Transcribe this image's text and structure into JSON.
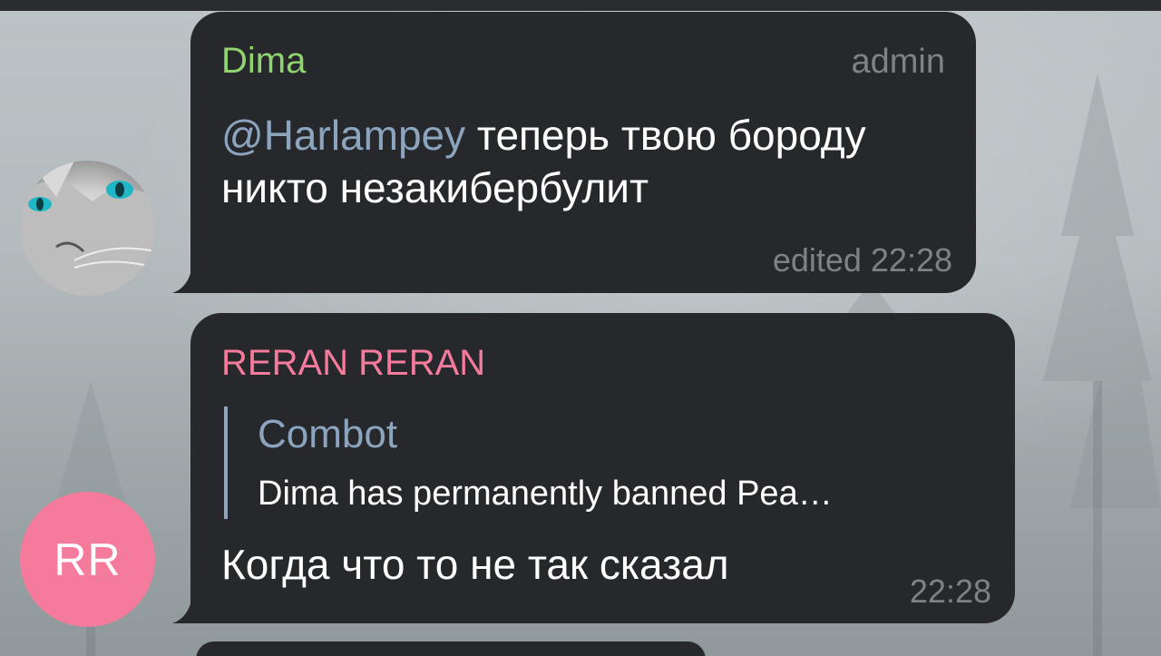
{
  "messages": [
    {
      "sender": "Dima",
      "role": "admin",
      "mention": "@Harlampey",
      "text_after_mention": " теперь твою бороду никто незакибербулит",
      "status": "edited 22:28",
      "avatar_icon": "cat-avatar-icon"
    },
    {
      "sender": "RERAN RERAN",
      "avatar_initials": "RR",
      "reply": {
        "name": "Combot",
        "text": "Dima has permanently banned Pea…"
      },
      "text": "Когда что то не так сказал",
      "time": "22:28"
    }
  ],
  "colors": {
    "bubble": "#27282c",
    "dima_name": "#8fd46f",
    "reran_name": "#f47b9b",
    "mention": "#8ca5bf",
    "meta": "#7e8186",
    "rr_avatar": "#f47b9b"
  }
}
